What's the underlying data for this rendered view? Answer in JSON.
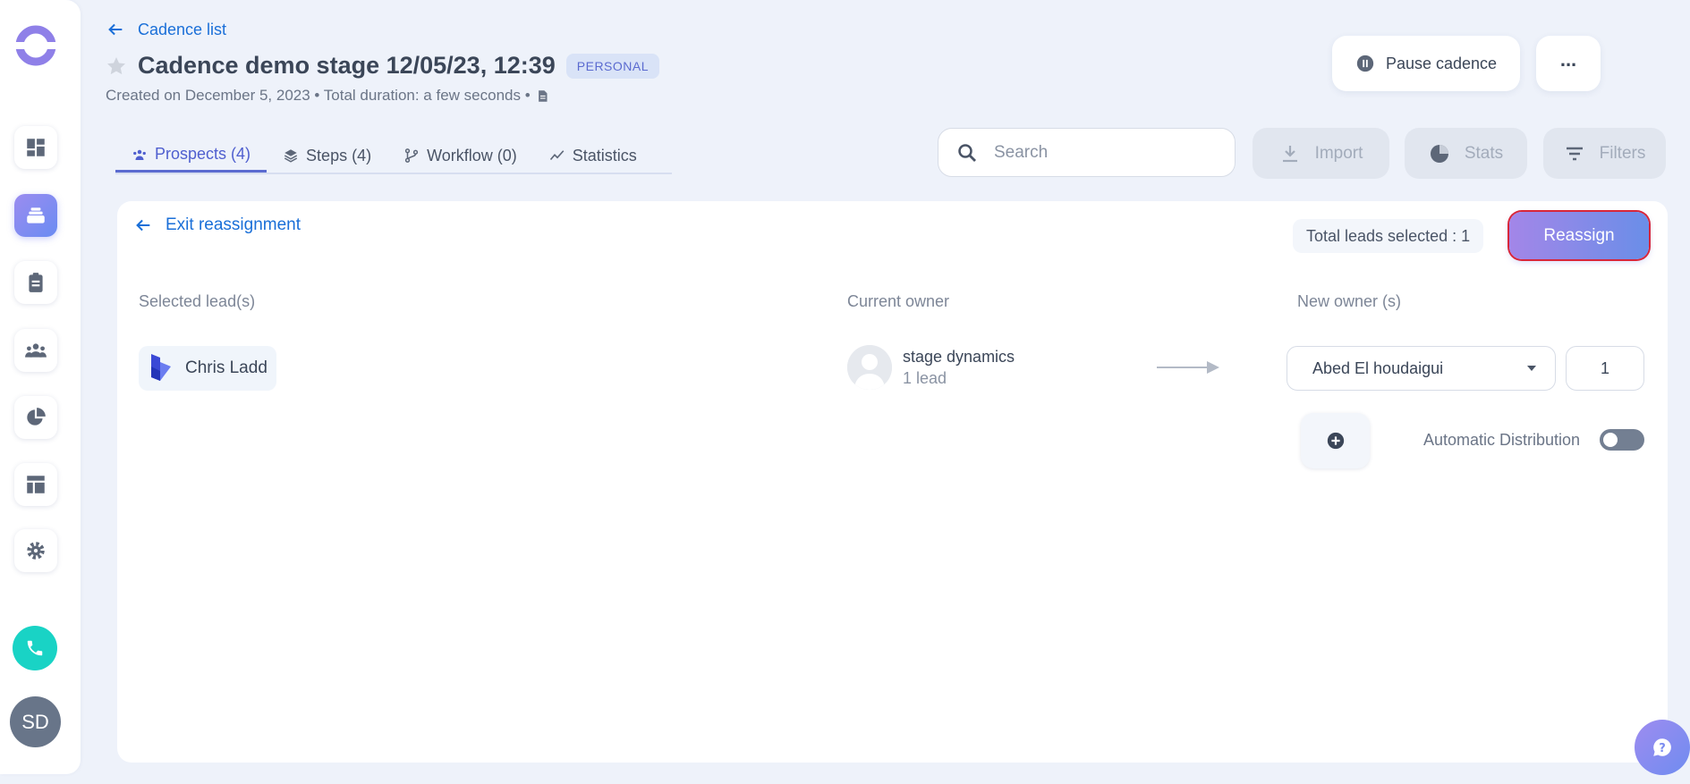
{
  "user": {
    "initials": "SD"
  },
  "header": {
    "back_label": "Cadence list",
    "title": "Cadence demo stage 12/05/23, 12:39",
    "badge": "PERSONAL",
    "meta": "Created on December 5, 2023 • Total duration: a few seconds •"
  },
  "actions": {
    "pause_label": "Pause cadence",
    "more_label": "..."
  },
  "tabs": [
    {
      "label": "Prospects (4)",
      "icon": "users-icon"
    },
    {
      "label": "Steps (4)",
      "icon": "layers-icon"
    },
    {
      "label": "Workflow (0)",
      "icon": "workflow-icon"
    },
    {
      "label": "Statistics",
      "icon": "chart-line-icon"
    }
  ],
  "search": {
    "placeholder": "Search"
  },
  "toolbar": {
    "import_label": "Import",
    "stats_label": "Stats",
    "filters_label": "Filters"
  },
  "reassignment": {
    "exit_label": "Exit reassignment",
    "total_label": "Total leads selected : 1",
    "reassign_label": "Reassign",
    "col_selected": "Selected lead(s)",
    "col_current": "Current owner",
    "col_new": "New owner (s)",
    "lead_name": "Chris Ladd",
    "current_owner_name": "stage dynamics",
    "current_owner_count": "1 lead",
    "new_owner_selected": "Abed El houdaigui",
    "new_owner_count": "1",
    "auto_distribution_label": "Automatic Distribution",
    "auto_distribution_on": false
  },
  "colors": {
    "accent": "#5b6bd0",
    "link": "#1a6fd8",
    "phone": "#19d3c5",
    "reassign_border": "#d8263a"
  }
}
